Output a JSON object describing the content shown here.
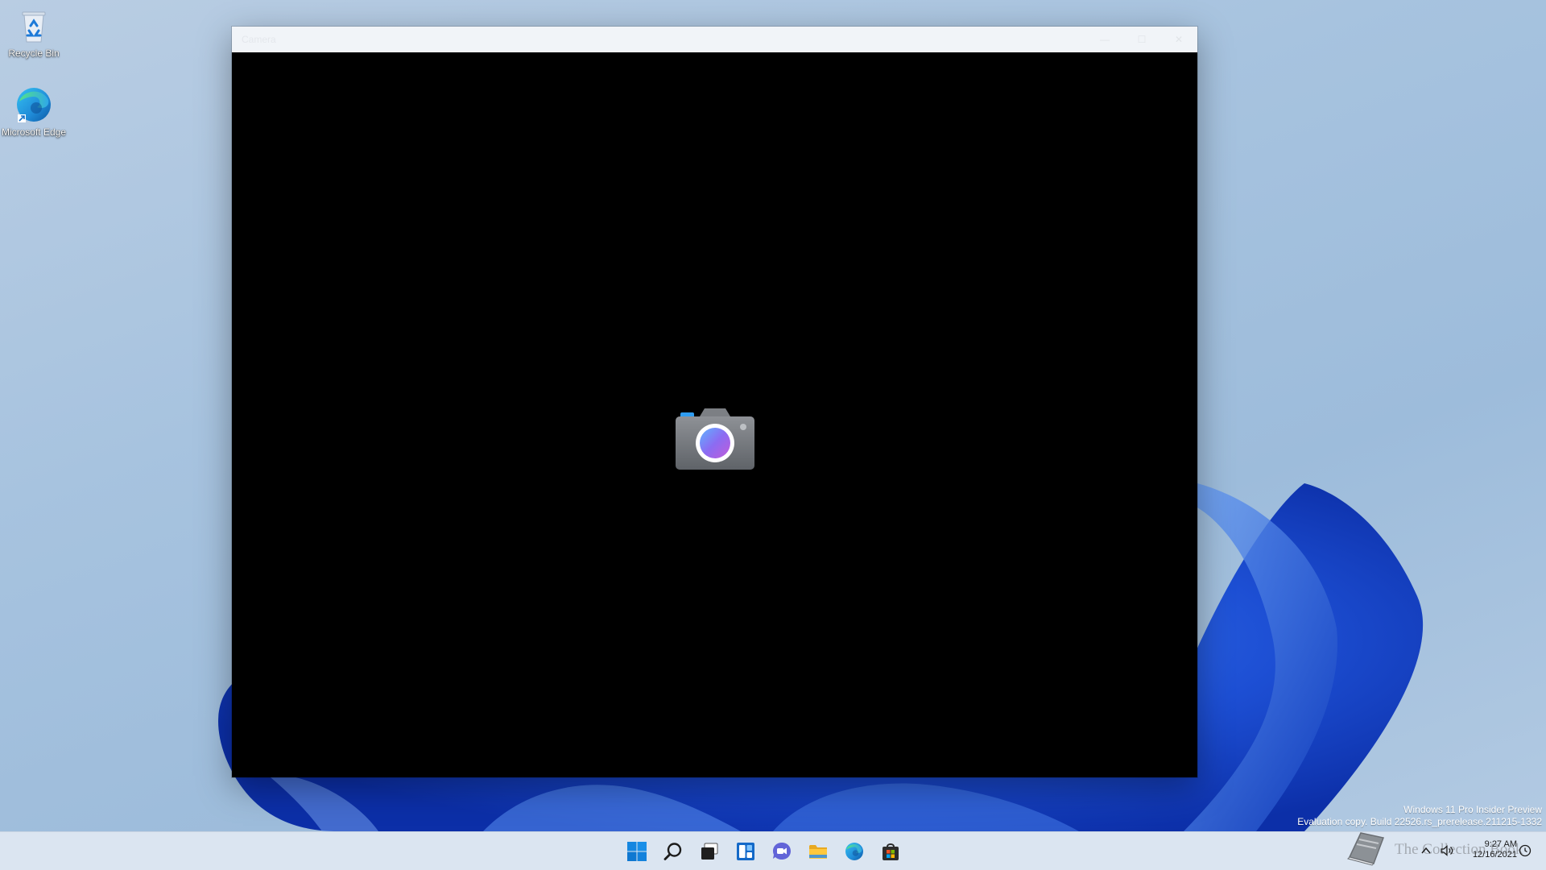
{
  "desktop": {
    "icons": [
      {
        "label": "Recycle Bin",
        "icon": "recycle-bin-icon"
      },
      {
        "label": "Microsoft Edge",
        "icon": "edge-icon"
      }
    ]
  },
  "window": {
    "title": "Camera",
    "caption_buttons": {
      "minimize": "—",
      "maximize": "☐",
      "close": "✕"
    },
    "logo": "camera-app-icon"
  },
  "watermark": {
    "line1": "Windows 11 Pro Insider Preview",
    "line2": "Evaluation copy. Build 22526.rs_prerelease.211215-1332"
  },
  "taskbar": {
    "items": [
      {
        "name": "start",
        "icon": "windows-logo-icon"
      },
      {
        "name": "search",
        "icon": "search-icon"
      },
      {
        "name": "task-view",
        "icon": "task-view-icon"
      },
      {
        "name": "widgets",
        "icon": "widgets-icon"
      },
      {
        "name": "chat",
        "icon": "teams-chat-icon"
      },
      {
        "name": "file-explorer",
        "icon": "folder-icon"
      },
      {
        "name": "edge",
        "icon": "edge-icon"
      },
      {
        "name": "store",
        "icon": "store-icon"
      }
    ],
    "overlay_text": "The Collection Book",
    "tray": {
      "time": "9:27 AM",
      "date": "12/16/2021"
    }
  },
  "colors": {
    "accent": "#0078d4",
    "wallpaper_bloom": "#1f55d6",
    "taskbar": "#dbe5f1"
  }
}
